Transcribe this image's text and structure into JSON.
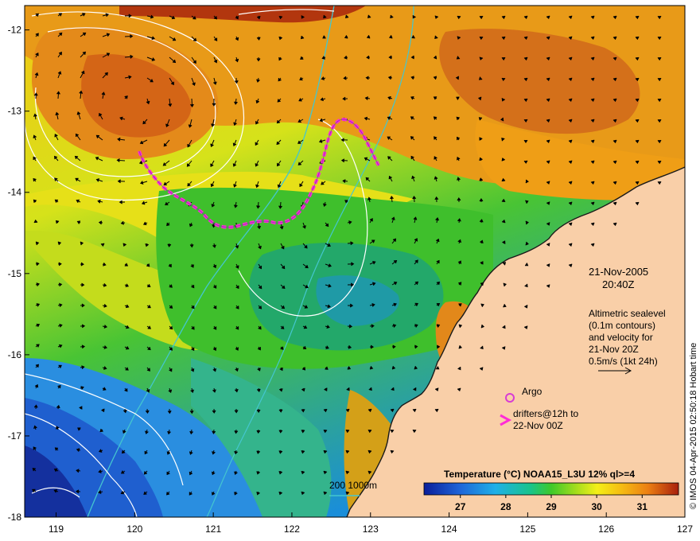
{
  "map": {
    "lon_ticks": [
      "119",
      "120",
      "121",
      "122",
      "123",
      "124",
      "125",
      "126",
      "127"
    ],
    "lat_ticks": [
      "-12",
      "-13",
      "-14",
      "-15",
      "-16",
      "-17",
      "-18"
    ],
    "lon_range": [
      118.6,
      127
    ],
    "lat_range": [
      -18,
      -11.7
    ]
  },
  "annotations": {
    "date": "21-Nov-2005",
    "time": "20:40Z",
    "altimetry_lines": [
      "Altimetric sealevel",
      "(0.1m contours)",
      "and velocity for",
      "21-Nov 20Z",
      "0.5m/s (1kt 24h)"
    ],
    "argo_label": "Argo",
    "drifters_line1": "drifters@12h to",
    "drifters_line2": "22-Nov 00Z",
    "depth_legend": "200  1000m"
  },
  "colorbar": {
    "title": "Temperature (°C) NOAA15_L3U 12% ql>=4",
    "ticks": [
      "27",
      "28",
      "29",
      "30",
      "31"
    ],
    "tick_values": [
      27,
      28,
      29,
      30,
      31
    ],
    "range": [
      26.2,
      31.8
    ]
  },
  "credit": "© IMOS 04-Apr-2015 02:50:18 Hobart time",
  "colors": {
    "land": "#f9cfa8",
    "drifter": "#ff2bd6",
    "argo": "#d83cd4",
    "isobath": "#44c6cf",
    "sealevel_contour": "#ffffff"
  }
}
